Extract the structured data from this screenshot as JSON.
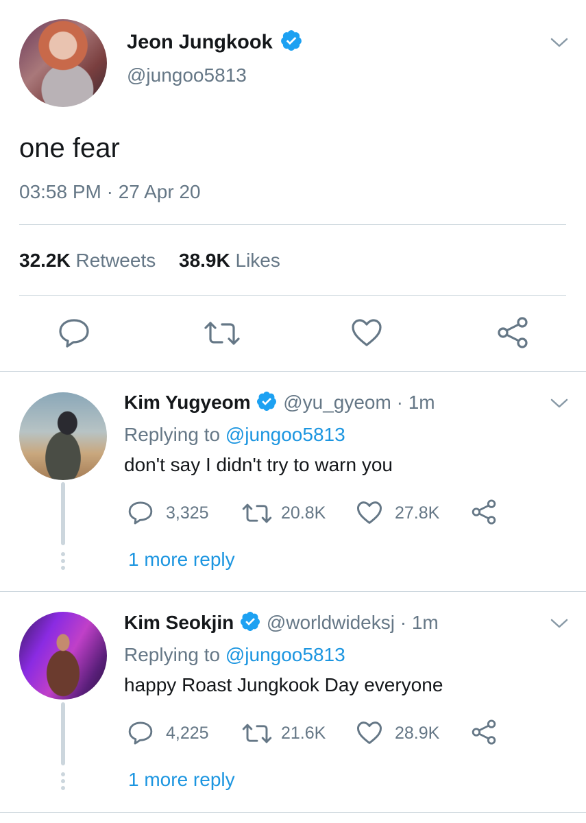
{
  "main_tweet": {
    "author_name": "Jeon Jungkook",
    "author_handle": "@jungoo5813",
    "text": "one fear",
    "timestamp": "03:58 PM · 27 Apr 20",
    "retweets_count": "32.2K",
    "retweets_label": "Retweets",
    "likes_count": "38.9K",
    "likes_label": "Likes"
  },
  "replies": [
    {
      "author_name": "Kim Yugyeom",
      "author_handle": "@yu_gyeom",
      "time": "· 1m",
      "replying_prefix": "Replying to",
      "replying_handle": "@jungoo5813",
      "text": "don't say I didn't try to warn you",
      "reply_count": "3,325",
      "retweet_count": "20.8K",
      "like_count": "27.8K",
      "more_replies": "1 more reply"
    },
    {
      "author_name": "Kim Seokjin",
      "author_handle": "@worldwideksj",
      "time": "· 1m",
      "replying_prefix": "Replying to",
      "replying_handle": "@jungoo5813",
      "text": "happy Roast Jungkook Day everyone",
      "reply_count": "4,225",
      "retweet_count": "21.6K",
      "like_count": "28.9K",
      "more_replies": "1 more reply"
    }
  ],
  "colors": {
    "accent": "#1b95e0",
    "verified": "#1da1f2",
    "secondary_text": "#657786",
    "divider": "#ccd6dd"
  },
  "icons": [
    "verified-badge-icon",
    "chevron-down-icon",
    "reply-icon",
    "retweet-icon",
    "like-icon",
    "share-icon"
  ]
}
